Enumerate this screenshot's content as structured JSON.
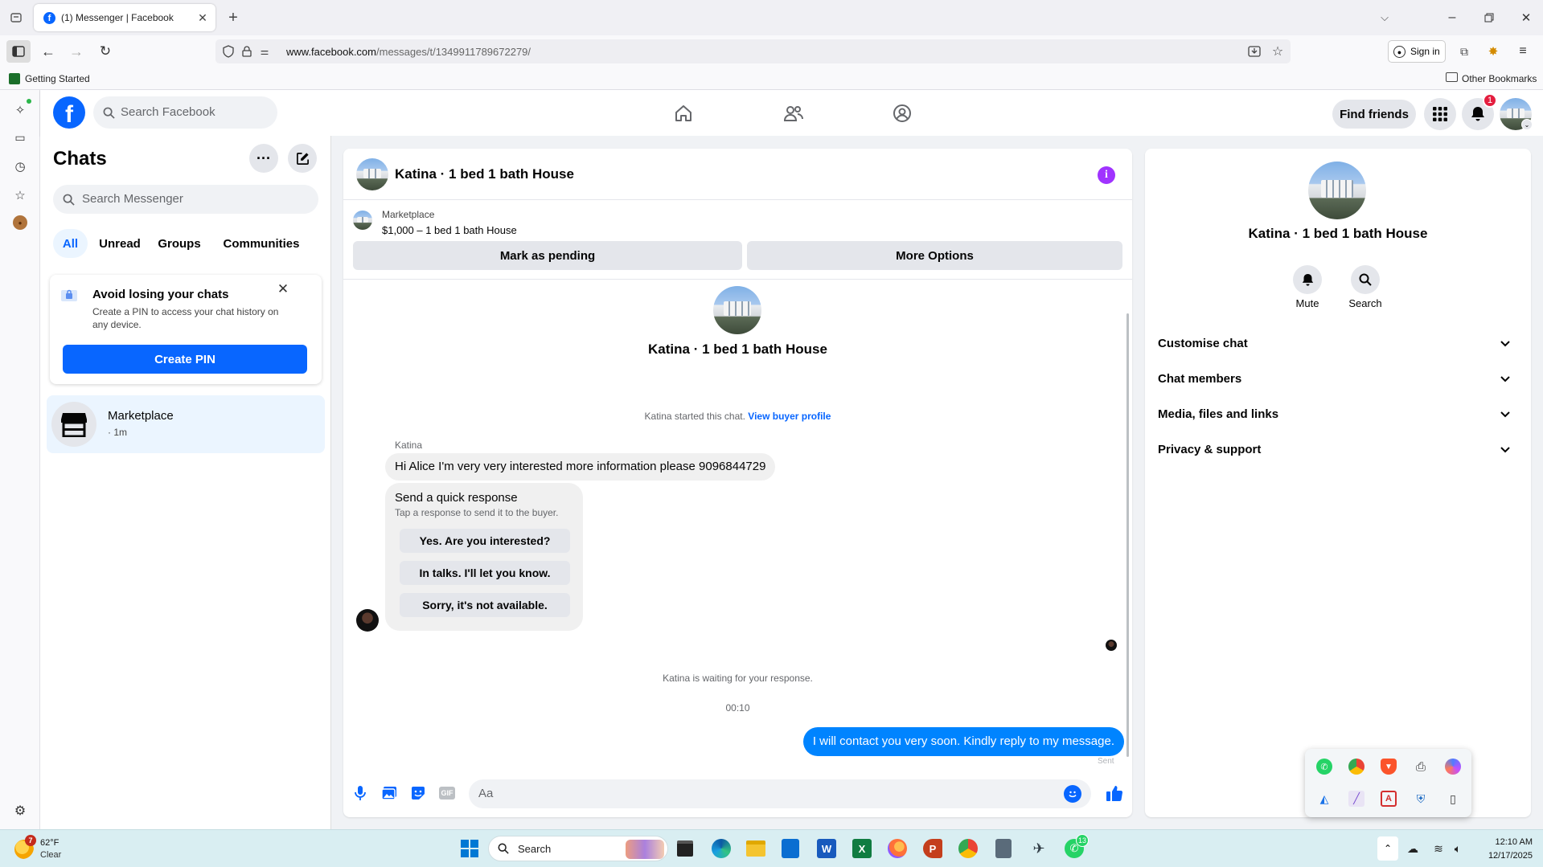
{
  "browser": {
    "tab_title": "(1) Messenger | Facebook",
    "url_domain": "www.facebook.com",
    "url_path": "/messages/t/1349911789672279/",
    "sign_in": "Sign in",
    "bookmark_getting_started": "Getting Started",
    "bookmark_other": "Other Bookmarks"
  },
  "fb": {
    "search_placeholder": "Search Facebook",
    "find_friends": "Find friends",
    "notification_count": "1"
  },
  "chats": {
    "title": "Chats",
    "search_placeholder": "Search Messenger",
    "filters": [
      "All",
      "Unread",
      "Groups",
      "Communities"
    ],
    "pin_card": {
      "title": "Avoid losing your chats",
      "body": "Create a PIN to access your chat history on any device.",
      "button": "Create PIN"
    },
    "items": [
      {
        "name": "Marketplace",
        "meta": "· 1m"
      }
    ]
  },
  "conversation": {
    "title": "Katina · 1 bed 1 bath House",
    "listing_source": "Marketplace",
    "listing_line": "$1,000 – 1 bed 1 bath House",
    "mark_pending": "Mark as pending",
    "more_options": "More Options",
    "header_name": "Katina · 1 bed 1 bath House",
    "started_text": "Katina started this chat.",
    "view_profile": "View buyer profile",
    "sender": "Katina",
    "incoming_message": "Hi Alice I'm very very interested more information please 9096844729",
    "quick_title": "Send a quick response",
    "quick_sub": "Tap a response to send it to the buyer.",
    "quick_options": [
      "Yes. Are you interested?",
      "In talks. I'll let you know.",
      "Sorry, it's not available."
    ],
    "waiting_text": "Katina is waiting for your response.",
    "timestamp": "00:10",
    "outgoing_message": "I will contact you very soon. Kindly reply to my message.",
    "sent_label": "Sent",
    "composer_placeholder": "Aa"
  },
  "info_panel": {
    "name": "Katina · 1 bed 1 bath House",
    "mute": "Mute",
    "search": "Search",
    "sections": [
      "Customise chat",
      "Chat members",
      "Media, files and links",
      "Privacy & support"
    ]
  },
  "taskbar": {
    "weather_temp": "62°F",
    "weather_desc": "Clear",
    "weather_badge": "7",
    "search_label": "Search",
    "whatsapp_badge": "13",
    "time": "12:10 AM",
    "date": "12/17/2025"
  },
  "colors": {
    "fb_blue": "#0866ff",
    "messenger_blue": "#0084ff",
    "accent_purple": "#a033ff",
    "badge_red": "#e41e3f"
  }
}
